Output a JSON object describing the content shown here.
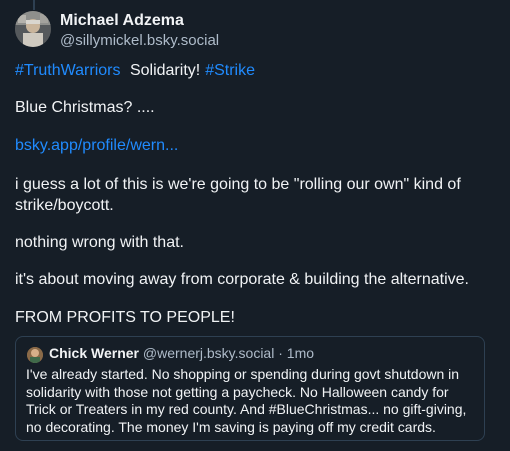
{
  "post": {
    "author": {
      "name": "Michael Adzema",
      "handle": "@sillymickel.bsky.social"
    },
    "tags": {
      "tag1": "#TruthWarriors",
      "text": "Solidarity!",
      "tag2": "#Strike"
    },
    "lines": {
      "blue_christmas": "Blue Christmas? ....",
      "link": "bsky.app/profile/wern...",
      "guess_1": "i guess a lot of this is we're going to be \"rolling our own\" kind of",
      "guess_2": "strike/boycott.",
      "nothing_wrong": "nothing wrong with that.",
      "moving_away": "it's about moving away from corporate & building the alternative.",
      "profits": "FROM PROFITS TO PEOPLE!"
    }
  },
  "quote": {
    "name": "Chick Werner",
    "handle": "@wernerj.bsky.social",
    "separator": "·",
    "time": "1mo",
    "lines": [
      "I've already started. No shopping or spending during govt shutdown in",
      "solidarity with those not getting a paycheck. No Halloween candy for",
      "Trick or Treaters in my red county. And #BlueChristmas... no gift-giving,",
      "no decorating. The money I'm saving is paying off my credit cards."
    ]
  },
  "colors": {
    "background": "#161e27",
    "text": "#f1f3f5",
    "muted": "#aebbc9",
    "link": "#208bfe",
    "border": "#2e4052"
  }
}
